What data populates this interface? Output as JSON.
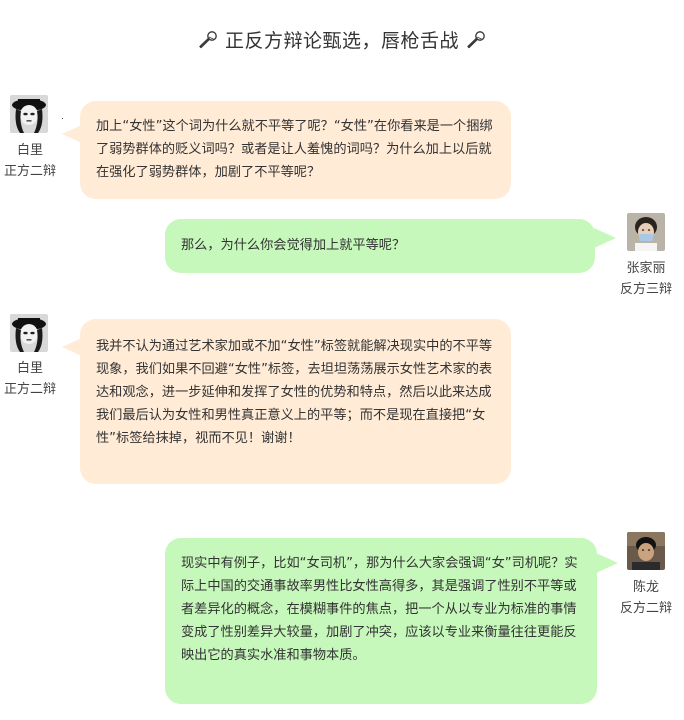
{
  "title": "正反方辩论甄选，唇枪舌战",
  "messages": [
    {
      "side": "left",
      "speaker": "白里",
      "role": "正方二辩",
      "text": "加上“女性”这个词为什么就不平等了呢？“女性”在你看来是一个捆绑了弱势群体的贬义词吗？或者是让人羞愧的词吗？为什么加上以后就在强化了弱势群体，加剧了不平等呢？"
    },
    {
      "side": "right",
      "speaker": "张家丽",
      "role": "反方三辩",
      "text": "那么，为什么你会觉得加上就平等呢？"
    },
    {
      "side": "left",
      "speaker": "白里",
      "role": "正方二辩",
      "text": "我并不认为通过艺术家加或不加“女性”标签就能解决现实中的不平等现象，我们如果不回避“女性”标签，去坦坦荡荡展示女性艺术家的表达和观念，进一步延伸和发挥了女性的优势和特点，然后以此来达成我们最后认为女性和男性真正意义上的平等；而不是现在直接把“女性”标签给抹掉，视而不见！谢谢！"
    },
    {
      "side": "right",
      "speaker": "陈龙",
      "role": "反方二辩",
      "text": "现实中有例子，比如“女司机”，那为什么大家会强调“女”司机呢？实际上中国的交通事故率男性比女性高得多，其是强调了性别不平等或者差异化的概念，在模糊事件的焦点，把一个从以专业为标准的事情变成了性别差异大较量，加剧了冲突，应该以专业来衡量往往更能反映出它的真实水准和事物本质。"
    }
  ],
  "colors": {
    "left_bubble": "#ffebd6",
    "right_bubble": "#c6f7bb"
  },
  "icons": {
    "title_decoration": "microphone-icon"
  }
}
